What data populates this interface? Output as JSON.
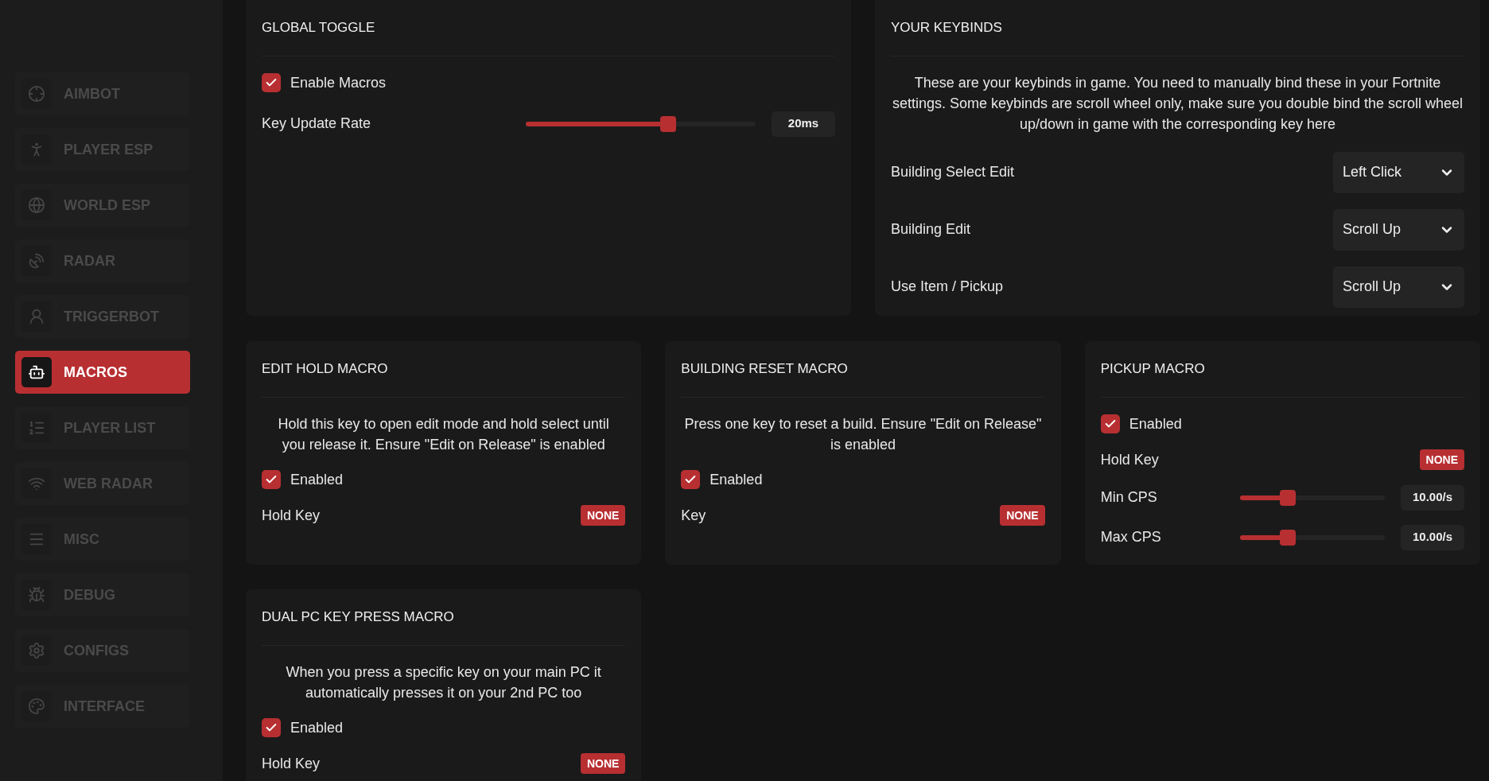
{
  "sidebar": {
    "items": [
      {
        "label": "AIMBOT",
        "selected": false
      },
      {
        "label": "PLAYER ESP",
        "selected": false
      },
      {
        "label": "WORLD ESP",
        "selected": false
      },
      {
        "label": "RADAR",
        "selected": false
      },
      {
        "label": "TRIGGERBOT",
        "selected": false
      },
      {
        "label": "MACROS",
        "selected": true
      },
      {
        "label": "PLAYER LIST",
        "selected": false
      },
      {
        "label": "WEB RADAR",
        "selected": false
      },
      {
        "label": "MISC",
        "selected": false
      },
      {
        "label": "DEBUG",
        "selected": false
      },
      {
        "label": "CONFIGS",
        "selected": false
      },
      {
        "label": "INTERFACE",
        "selected": false
      }
    ]
  },
  "global_toggle": {
    "title": "GLOBAL TOGGLE",
    "toggle": {
      "label": "Enable Macros",
      "checked": true
    },
    "slider": {
      "label": "Key Update Rate",
      "level": 0.62,
      "reading": "20ms"
    }
  },
  "keybinds": {
    "title": "YOUR KEYBINDS",
    "description": "These are your keybinds in game. You need to manually bind these in your Fortnite settings. Some keybinds are scroll wheel only, make sure you double bind the scroll wheel up/down in game with the corresponding key here",
    "binds": [
      {
        "label": "Building Select Edit",
        "value": "Left Click"
      },
      {
        "label": "Building Edit",
        "value": "Scroll Up"
      },
      {
        "label": "Use Item / Pickup",
        "value": "Scroll Up"
      }
    ]
  },
  "macros": [
    {
      "title": "EDIT HOLD MACRO",
      "description": "Hold this key to open edit mode and hold select until you release it. Ensure \"Edit on Release\" is enabled",
      "toggle": {
        "label": "Enabled",
        "checked": true
      },
      "key": {
        "label": "Hold Key",
        "value": "NONE"
      }
    },
    {
      "title": "BUILDING RESET MACRO",
      "description": "Press one key to reset a build. Ensure \"Edit on Release\" is enabled",
      "toggle": {
        "label": "Enabled",
        "checked": true
      },
      "key": {
        "label": "Key",
        "value": "NONE"
      }
    },
    {
      "title": "PICKUP MACRO",
      "toggle": {
        "label": "Enabled",
        "checked": true
      },
      "key": {
        "label": "Hold Key",
        "value": "NONE"
      },
      "sliders": [
        {
          "label": "Min CPS",
          "level": 0.33,
          "reading": "10.00/s"
        },
        {
          "label": "Max CPS",
          "level": 0.33,
          "reading": "10.00/s"
        }
      ]
    },
    {
      "title": "DUAL PC KEY PRESS MACRO",
      "description": "When you press a specific key on your main PC it automatically presses it on your 2nd PC too",
      "toggle": {
        "label": "Enabled",
        "checked": true
      },
      "key": {
        "label": "Hold Key",
        "value": "NONE"
      }
    }
  ]
}
